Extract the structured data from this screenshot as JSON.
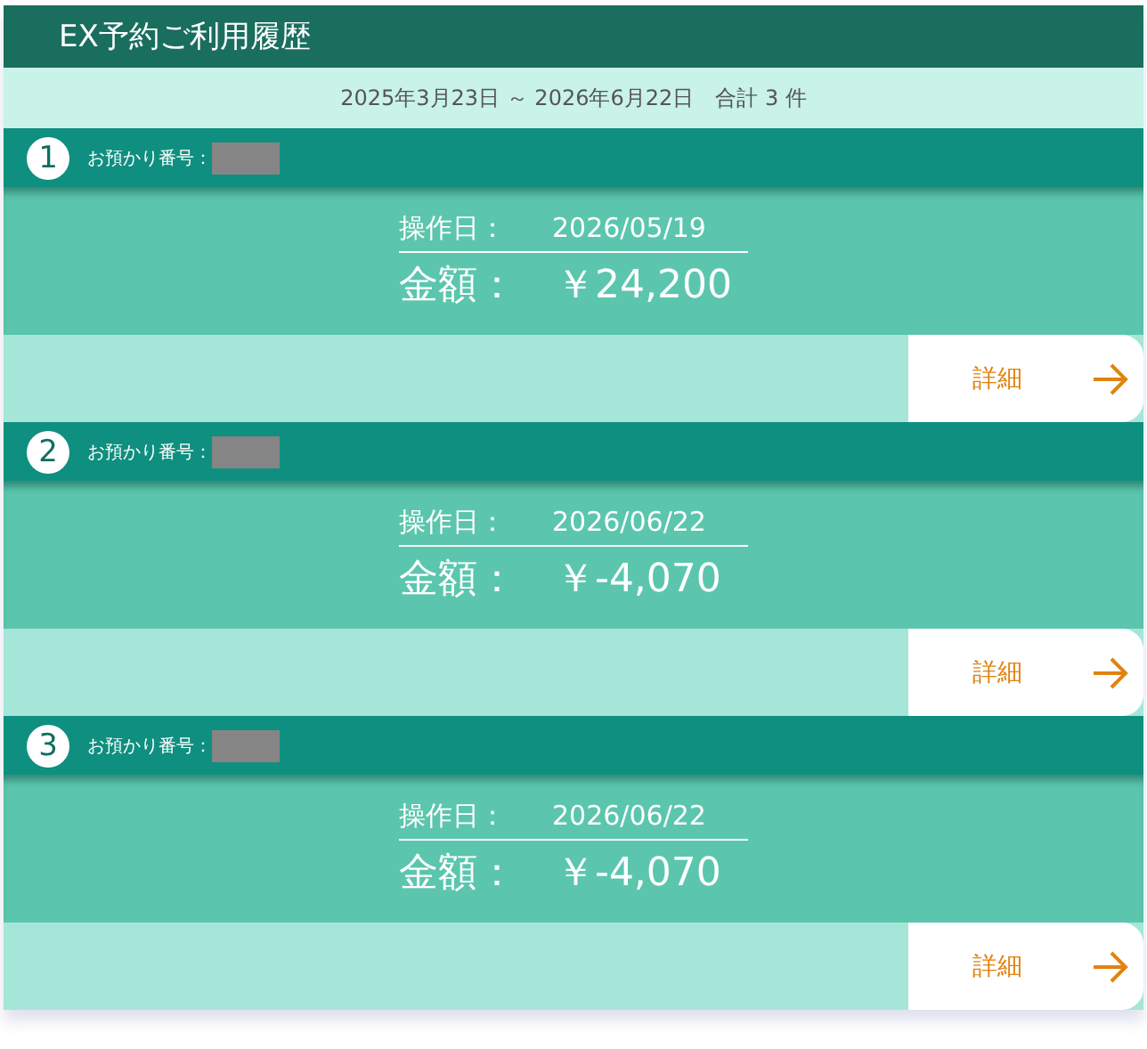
{
  "header": {
    "title": "EX予約ご利用履歴"
  },
  "summary": {
    "period": "2025年3月23日 ～ 2026年6月22日",
    "total": "合計 3 件"
  },
  "records": [
    {
      "number": "1",
      "reservation_label": "お預かり番号：",
      "date_label": "操作日：",
      "date": "2026/05/19",
      "amount_label": "金額：",
      "amount": "￥24,200",
      "detail_button": "詳細"
    },
    {
      "number": "2",
      "reservation_label": "お預かり番号：",
      "date_label": "操作日：",
      "date": "2026/06/22",
      "amount_label": "金額：",
      "amount": "￥-4,070",
      "detail_button": "詳細"
    },
    {
      "number": "3",
      "reservation_label": "お預かり番号：",
      "date_label": "操作日：",
      "date": "2026/06/22",
      "amount_label": "金額：",
      "amount": "￥-4,070",
      "detail_button": "詳細"
    }
  ]
}
